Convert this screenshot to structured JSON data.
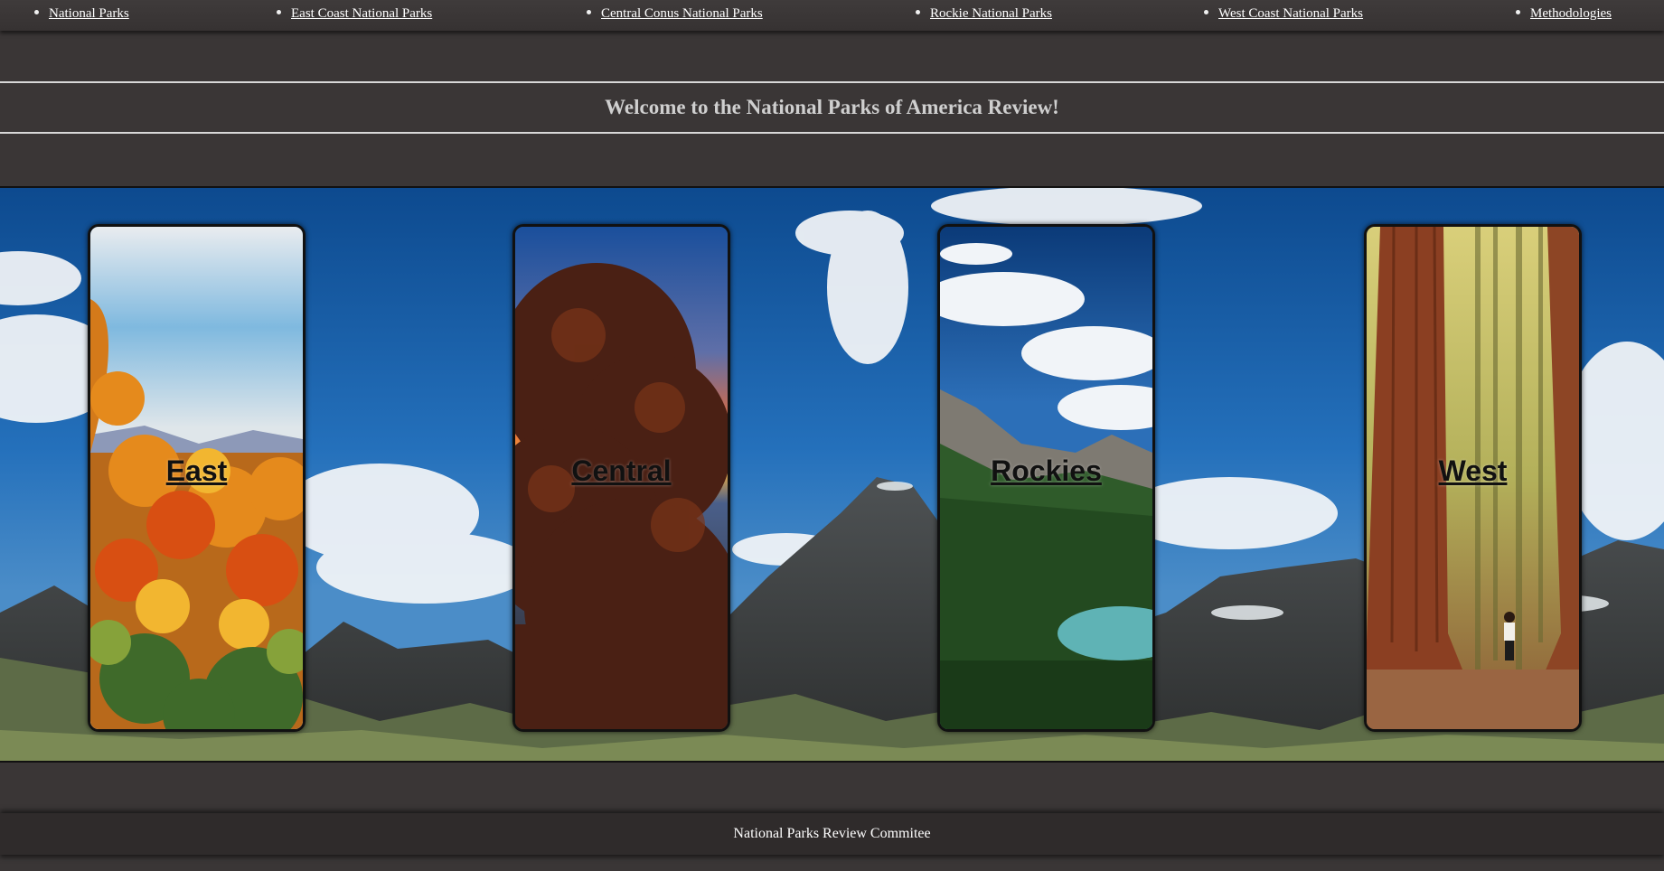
{
  "nav": {
    "items": [
      {
        "label": "National Parks"
      },
      {
        "label": "East Coast National Parks"
      },
      {
        "label": "Central Conus National Parks"
      },
      {
        "label": "Rockie National Parks"
      },
      {
        "label": "West Coast National Parks"
      },
      {
        "label": "Methodologies"
      }
    ]
  },
  "header": {
    "title": "Welcome to the National Parks of America Review!"
  },
  "hero": {
    "cards": [
      {
        "label": "East"
      },
      {
        "label": "Central"
      },
      {
        "label": "Rockies"
      },
      {
        "label": "West"
      }
    ]
  },
  "footer": {
    "text": "National Parks Review Commitee"
  },
  "colors": {
    "page_background": "#3a3636",
    "footer_background": "#2f2b2b",
    "heading_text": "#cfcfcf",
    "card_label": "#111111"
  }
}
